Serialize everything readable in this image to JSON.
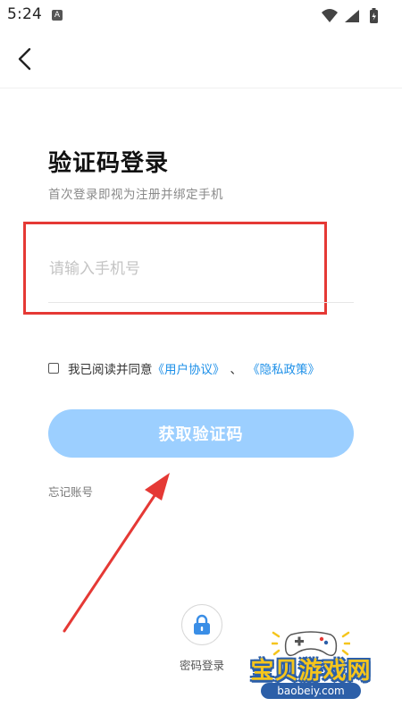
{
  "status_bar": {
    "time": "5:24",
    "notification_icon": "A"
  },
  "header": {
    "back_icon": "chevron-left-icon"
  },
  "login": {
    "title": "验证码登录",
    "subtitle": "首次登录即视为注册并绑定手机",
    "phone_placeholder": "请输入手机号",
    "agree_prefix": "我已阅读并同意",
    "user_agreement": "《用户协议》",
    "separator": "、",
    "privacy_policy": "《隐私政策》",
    "get_code_button": "获取验证码",
    "forgot_account": "忘记账号",
    "password_login": "密码登录"
  },
  "watermark": {
    "text": "宝贝游戏网",
    "url": "baobeiy.com"
  },
  "colors": {
    "primary_button": "#9ccfff",
    "link": "#1e90e8",
    "highlight_box": "#e53935",
    "annotation_arrow": "#e53935"
  }
}
